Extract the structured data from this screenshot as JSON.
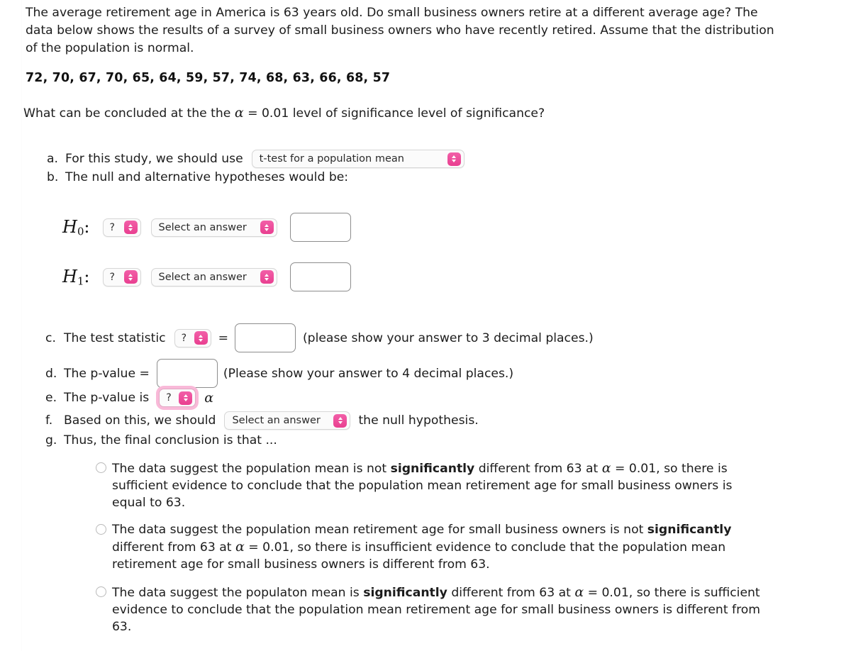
{
  "problem": {
    "intro": "The average retirement age in America is 63 years old. Do small business owners retire at a different average age? The data below shows the results of a survey of small business owners who have recently retired. Assume that the distribution of the population is normal.",
    "data_values": "72, 70, 67, 70, 65, 64, 59, 57, 74, 68, 63, 66, 68, 57",
    "question_prefix": "What can be concluded at the the ",
    "alpha_symbol": "α",
    "question_mid": " = 0.01 level of significance level of significance?"
  },
  "parts": {
    "a": {
      "marker": "a.",
      "label": "For this study, we should use",
      "select_value": "t-test for a population mean"
    },
    "b": {
      "marker": "b.",
      "label": "The null and alternative hypotheses would be:",
      "h0": {
        "math_h": "H",
        "math_sub": "0",
        "math_colon": ":",
        "param_select": "?",
        "answer_select": "Select an answer",
        "value_input": ""
      },
      "h1": {
        "math_h": "H",
        "math_sub": "1",
        "math_colon": ":",
        "param_select": "?",
        "answer_select": "Select an answer",
        "value_input": ""
      }
    },
    "c": {
      "marker": "c.",
      "label": "The test statistic",
      "stat_select": "?",
      "equals": "=",
      "value_input": "",
      "hint": "(please show your answer to 3 decimal places.)"
    },
    "d": {
      "marker": "d.",
      "label": "The p-value =",
      "value_input": "",
      "hint": "(Please show your answer to 4 decimal places.)"
    },
    "e": {
      "marker": "e.",
      "label": "The p-value is",
      "compare_select": "?",
      "alpha_symbol": "α"
    },
    "f": {
      "marker": "f.",
      "label": "Based on this, we should",
      "decision_select": "Select an answer",
      "label_after": "the null hypothesis."
    },
    "g": {
      "marker": "g.",
      "label": "Thus, the final conclusion is that ...",
      "choices": [
        {
          "pre": "The data suggest the population mean is not ",
          "bold": "significantly",
          "mid": " different from 63 at ",
          "alpha": "α",
          "post": " = 0.01, so there is sufficient evidence to conclude that the population mean retirement age for small business owners is equal to 63.",
          "selected": false
        },
        {
          "pre": "The data suggest the population mean retirement age for small business owners is not ",
          "bold": "significantly",
          "mid": " different from 63 at ",
          "alpha": "α",
          "post": " = 0.01, so there is insufficient evidence to conclude that the population mean retirement age for small business owners is different from 63.",
          "selected": false
        },
        {
          "pre": "The data suggest the populaton mean is ",
          "bold": "significantly",
          "mid": " different from 63 at ",
          "alpha": "α",
          "post": " = 0.01, so there is sufficient evidence to conclude that the population mean retirement age for small business owners is different from 63.",
          "selected": false
        }
      ]
    }
  },
  "colors": {
    "accent_pink": "#ec4899",
    "focus_ring": "#f9b9d8",
    "input_border": "#8d8d8d",
    "select_border": "#d6d6d6",
    "text": "#1c1c1c"
  }
}
